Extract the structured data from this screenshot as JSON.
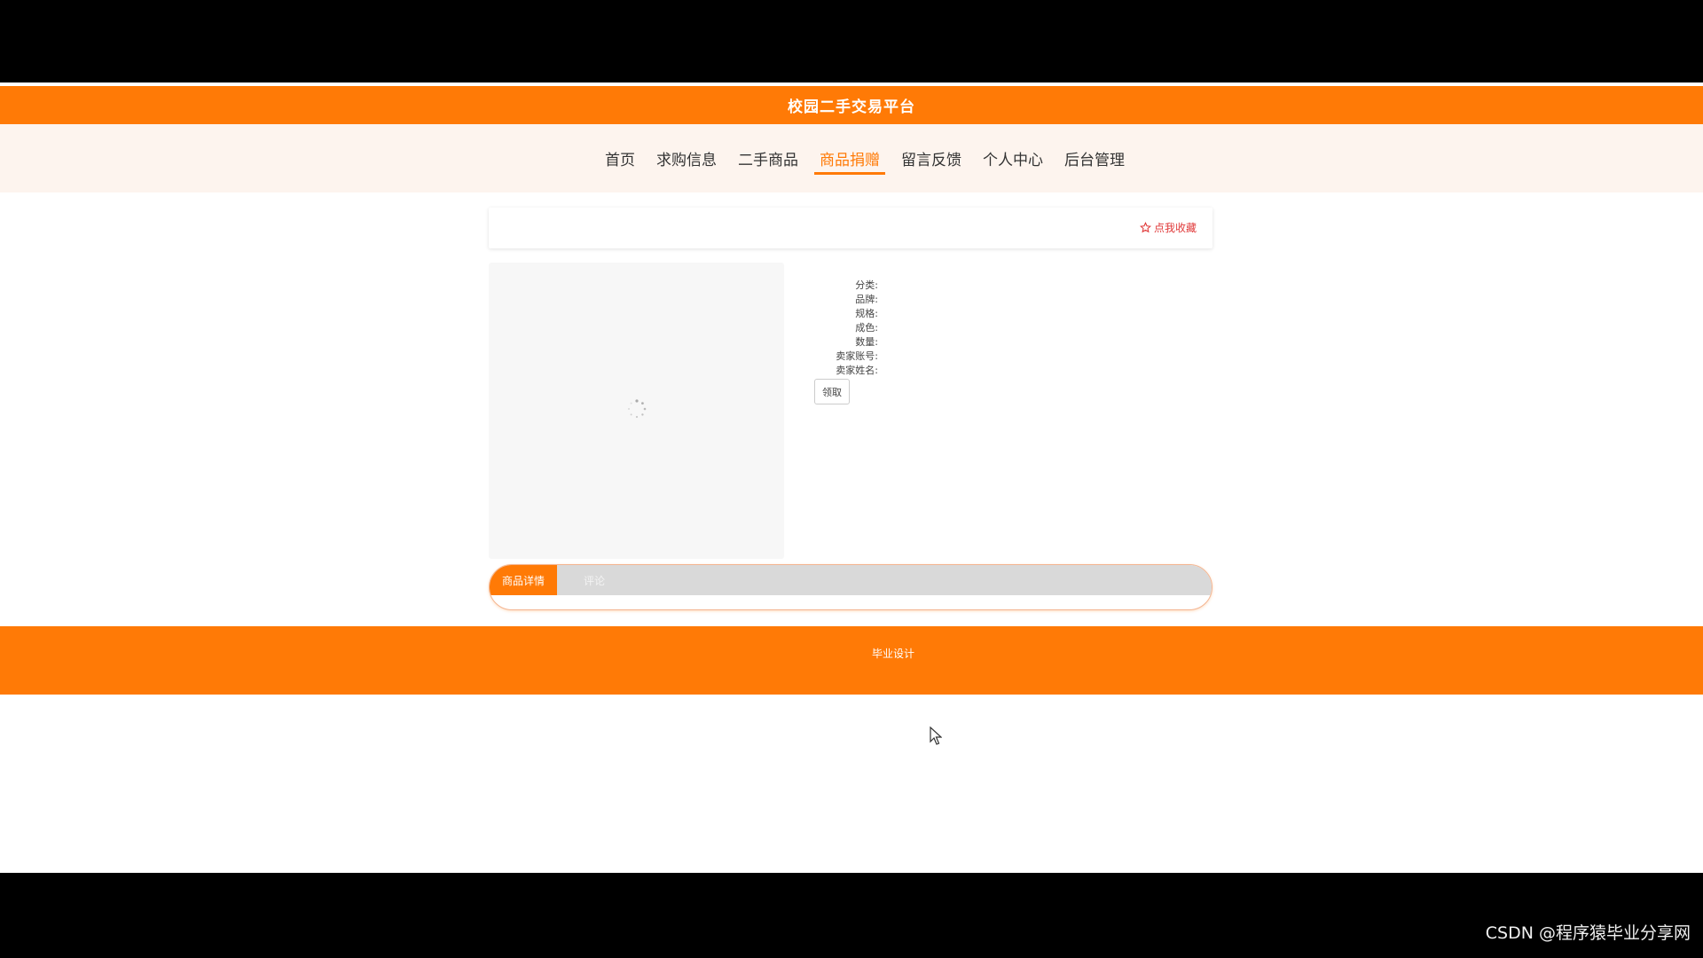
{
  "header": {
    "title": "校园二手交易平台"
  },
  "nav": {
    "items": [
      {
        "label": "首页",
        "active": false
      },
      {
        "label": "求购信息",
        "active": false
      },
      {
        "label": "二手商品",
        "active": false
      },
      {
        "label": "商品捐赠",
        "active": true
      },
      {
        "label": "留言反馈",
        "active": false
      },
      {
        "label": "个人中心",
        "active": false
      },
      {
        "label": "后台管理",
        "active": false
      }
    ]
  },
  "favorite": {
    "icon": "star-outline-icon",
    "label": "点我收藏"
  },
  "product": {
    "image_loading_icon": "loading-spinner-icon",
    "fields": [
      {
        "label": "分类:"
      },
      {
        "label": "品牌:"
      },
      {
        "label": "规格:"
      },
      {
        "label": "成色:"
      },
      {
        "label": "数量:"
      },
      {
        "label": "卖家账号:"
      },
      {
        "label": "卖家姓名:"
      }
    ],
    "claim_label": "领取"
  },
  "tabs": [
    {
      "label": "商品详情",
      "active": true
    },
    {
      "label": "评论",
      "active": false
    }
  ],
  "footer": {
    "text": "毕业设计"
  },
  "watermark": "CSDN @程序猿毕业分享网",
  "colors": {
    "accent": "#ff7a06",
    "nav_bg": "#fdf4ee",
    "favorite": "#e03a3a"
  }
}
